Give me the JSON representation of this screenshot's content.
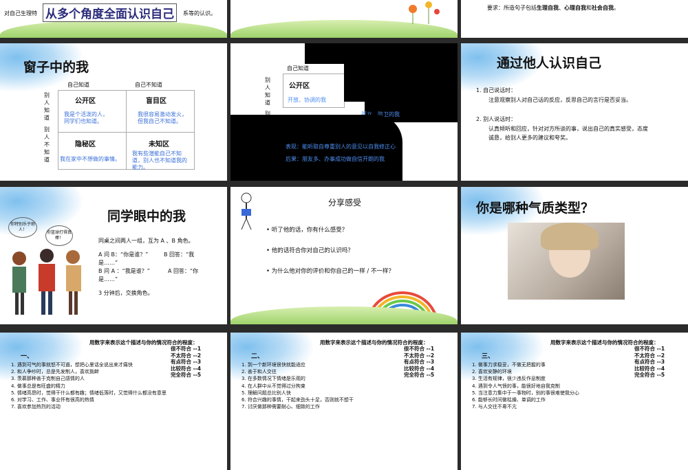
{
  "s1": {
    "title": "从多个角度全面认识自己",
    "text_left": "对自己生理特",
    "text_right": "系等的认识。"
  },
  "s3": {
    "req_prefix": "要求：所造句子包括",
    "req_a": "生理自我",
    "req_sep1": "、",
    "req_b": "心理自我",
    "req_sep2": "和",
    "req_c": "社会自我",
    "req_end": "。"
  },
  "s4": {
    "title": "窗子中的我",
    "col_known": "自己知道",
    "col_unknown": "自己不知道",
    "row_known": "别人知道",
    "row_unknown": "别人不知道",
    "q1": {
      "head": "公开区",
      "body": "我是个活泼的人，同学们也知道。"
    },
    "q2": {
      "head": "盲目区",
      "body": "我很容易激动发火，但我自己不知道。"
    },
    "q3": {
      "head": "隐秘区",
      "body": "我在家中不想做的事情。"
    },
    "q4": {
      "head": "未知区",
      "body": "我有些潜能自己不知道，别人也不知道我的能力。"
    }
  },
  "s5": {
    "col_known": "自己知道",
    "row_known": "别人知道",
    "row_unknown": "别",
    "q1_head": "公开区",
    "q1_body": "开放、协调的我",
    "q2_body": "孤立、防卫的我",
    "result1": "表现：能听取自尊重别人的意见以自我修正心",
    "result2": "后果：朋友多、办事成功做自信开朗的我"
  },
  "s6": {
    "title": "通过他人认识自己",
    "item1_title": "1.   自己说话时：",
    "item1_body": "注意观察别人对自己话的反应，反思自己的言行是否妥当。",
    "item2_title": "2.   别人说话时：",
    "item2_body1": "认真倾听和回应，针对对方所谈的事，说出自己的真实感受，态度",
    "item2_body2": "诚恳，给别人更多的建议和夸奖。"
  },
  "s7": {
    "title": "同学眼中的我",
    "bubble1": "你特别乐于助人！",
    "bubble2": "你篮球打得真棒！",
    "line1": "同桌之间两人一组，互为 A 、B 角色。",
    "line2a": "A 问 B：“你是谁？”",
    "line2b": "B 回答：“我",
    "line3": "是……”",
    "line4a": "B 问 A ：“我是谁？”",
    "line4b": "A 回答：“你",
    "line5": "是……”",
    "line6": "3 分钟后，交换角色。"
  },
  "s8": {
    "title": "分享感受",
    "q1": "听了他的话，你有什么感受？",
    "q2": "他的话符合你对自己的认识吗？",
    "q3": "为什么他对你的评价和你自己的一样 / 不一样？"
  },
  "s9": {
    "title": "你是哪种气质类型？"
  },
  "scale": {
    "header": "用数字来表示这个描述与你的情况符合的程度：",
    "levels": [
      "很不符合 --1",
      "不太符合 --2",
      "有点符合 --3",
      "比较符合 --4",
      "完全符合 --5"
    ]
  },
  "s10": {
    "label": "一、",
    "items": [
      "1.  遇到可气的事就怒不可遏，想把心里话全说出来才痛快",
      "2.  和人争吵时，总是先发制人，喜欢挑衅",
      "3.  羡慕那种善于克制自己感情的人",
      "4.  做事总是有旺盛的精力",
      "5.  情绪高昂时，觉得干什么都有趣；情绪低落时，又觉得什么都没有意思",
      "6.  对学习、工作、事业怀有很高的热情",
      "7.  喜欢参加热烈的活动"
    ]
  },
  "s11": {
    "label": "二、",
    "items": [
      "1.  到一个新环境很快就能适应",
      "2.  善于和人交往",
      "3.  在多数情况下情绪是乐观的",
      "4.  在人群中从不觉得过分拘束",
      "5.  理解问题总比别人快",
      "6.  符合兴趣的事情，干起来劲头十足，否则就不想干",
      "7.  讨厌做那种需要耐心、细致的工作"
    ]
  },
  "s12": {
    "label": "三、",
    "items": [
      "1.  做事力求稳妥，不做无把握的事",
      "2.  喜欢安静的环境",
      "3.  生活有规律，很少违反作息制度",
      "4.  遇到令人气愤的事，能很好地自我克制",
      "5.  当注意力集中于一事物时，别的事很难使我分心",
      "6.  能够长时间做枯燥、单调的工作",
      "7.  与人交往不卑不亢"
    ]
  }
}
